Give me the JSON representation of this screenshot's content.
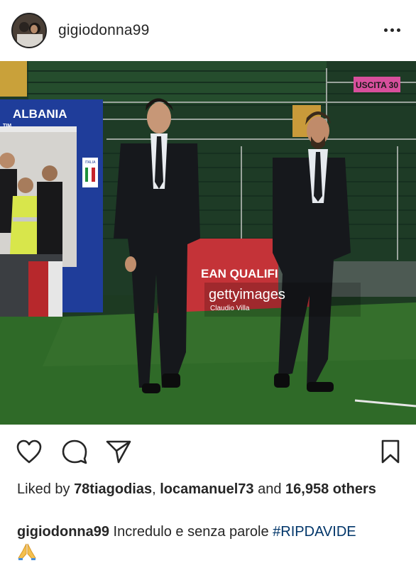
{
  "post": {
    "username": "gigiodonna99",
    "more_icon": "more-horizontal-icon"
  },
  "photo": {
    "banner_country": "ALBANIA",
    "banner_sub": "TIM",
    "exit_sign": "USCITA 30",
    "qualifier_text": "EAN QUALIFIER",
    "watermark_brand": "gettyimages",
    "watermark_credit": "Claudio Villa",
    "badge_text": "ITALIA"
  },
  "actions": {
    "like_icon": "heart-icon",
    "comment_icon": "comment-icon",
    "share_icon": "send-icon",
    "save_icon": "bookmark-icon"
  },
  "likes": {
    "prefix": "Liked by ",
    "user1": "78tiagodias",
    "separator": ", ",
    "user2": "locamanuel73",
    "and": " and ",
    "count": "16,958",
    "suffix": " others"
  },
  "caption": {
    "username": "gigiodonna99",
    "text": " Incredulo e senza parole ",
    "hashtag": "#RIPDAVIDE",
    "emoji": "🙏"
  },
  "colors": {
    "hashtag": "#003569",
    "text": "#262626"
  }
}
